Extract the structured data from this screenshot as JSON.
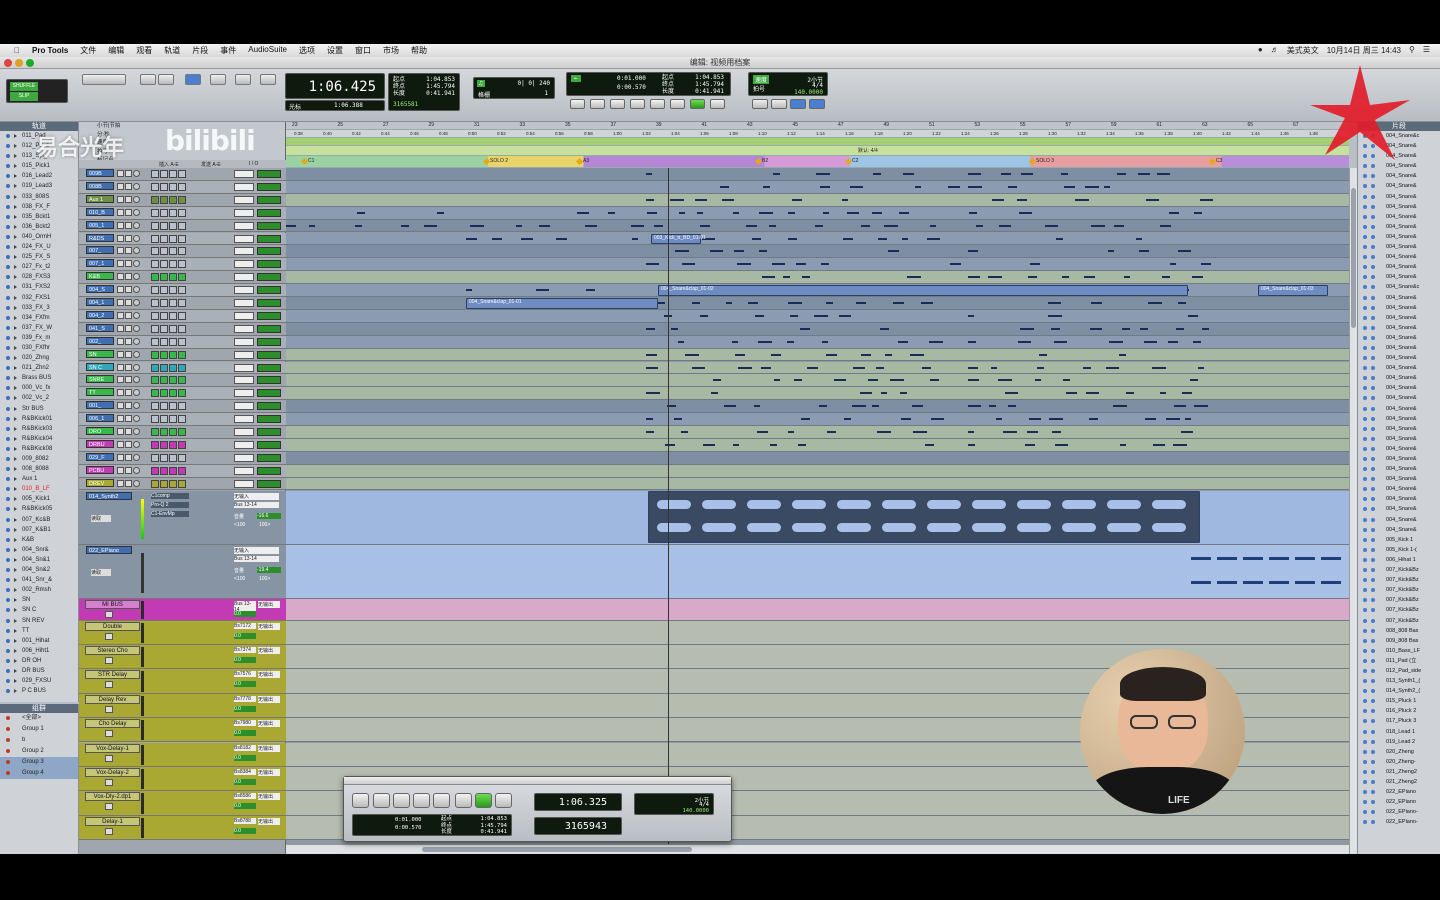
{
  "menubar": {
    "app_name": "Pro Tools",
    "items": [
      "文件",
      "编辑",
      "观看",
      "轨道",
      "片段",
      "事件",
      "AudioSuite",
      "选项",
      "设置",
      "窗口",
      "市场",
      "帮助"
    ],
    "input_method": "美式英文",
    "clock": "10月14日 周三  14:43"
  },
  "window": {
    "title": "编辑: 视频用档案"
  },
  "toolbar": {
    "mode_label": "SHUFFLE",
    "mode_sub": "SLIP",
    "main_counter": "1:06.425",
    "start_label": "起点",
    "end_label": "终点",
    "length_label": "长度",
    "start": "1:04.853",
    "end": "1:45.794",
    "length": "0:41.941",
    "cursor_label": "光标",
    "cursor_value": "1:06.388",
    "samples": "3165581",
    "nudge_value": "0| 0| 240",
    "grid_label": "格栅",
    "grid_value": "1",
    "preroll": "0:01.000",
    "postroll": "0:00.570",
    "tempo_label": "速度",
    "meter_label": "拍号",
    "meter_value": "4/4",
    "tempo_value": "140.0000",
    "beats_label": "2小节"
  },
  "rulers": {
    "labels": [
      "小节|节拍",
      "分:秒",
      "速度",
      "拍号",
      "标记点"
    ],
    "bar_numbers": [
      "23",
      "25",
      "27",
      "29",
      "31",
      "33",
      "35",
      "37",
      "39",
      "41",
      "43",
      "45",
      "47",
      "49",
      "51",
      "53",
      "55",
      "57",
      "59",
      "61",
      "63",
      "65",
      "67"
    ],
    "minsec": [
      "0:38",
      "0:40",
      "0:42",
      "0:44",
      "0:46",
      "0:48",
      "0:50",
      "0:52",
      "0:54",
      "0:56",
      "0:58",
      "1:00",
      "1:02",
      "1:04",
      "1:06",
      "1:08",
      "1:10",
      "1:12",
      "1:14",
      "1:16",
      "1:18",
      "1:20",
      "1:22",
      "1:24",
      "1:26",
      "1:28",
      "1:30",
      "1:32",
      "1:34",
      "1:36",
      "1:38",
      "1:40",
      "1:42",
      "1:44",
      "1:46",
      "1:48"
    ],
    "meter_marker": "默认: 4/4",
    "markers": [
      "C1",
      "SOLO 2",
      "A3",
      "B2",
      "C2",
      "SOLO 3",
      "C3"
    ]
  },
  "tracklist": {
    "title": "轨道",
    "items": [
      "011_Pad",
      "012_Pd_s",
      "013_Syl_",
      "015_Pick1",
      "016_Lead2",
      "019_Lead3",
      "033_808S",
      "038_FX_F",
      "035_Bckt1",
      "036_Bckt2",
      "040_OrmH",
      "024_FX_U",
      "025_FX_S",
      "027_Fx_t2",
      "028_FXS3",
      "031_FXS2",
      "032_FXS1",
      "033_FX_3",
      "034_FXfm",
      "037_FX_W",
      "039_Fx_m",
      "030_FXfhr",
      "020_Zhng",
      "021_Zhn2",
      "Brass BUS",
      "000_Vc_fx",
      "002_Vc_2",
      "Str BUS",
      "R&BKick01",
      "R&BKick03",
      "R&BKick04",
      "R&BKick08",
      "009_8082",
      "008_8088",
      "Aux 1",
      "010_B_LF",
      "005_Kick1",
      "R&BKick05",
      "007_Kc&B",
      "007_K&B1",
      "K&B",
      "004_Snr&",
      "004_Sn&1",
      "004_Sn&2",
      "041_Snr_&",
      "002_Rmsh",
      "SN",
      "SN C",
      "SN REV",
      "TT",
      "001_Hihat",
      "006_Hiht1",
      "DR OH",
      "DR BUS",
      "029_FXSU",
      "P C BUS"
    ]
  },
  "groups": {
    "title": "组群",
    "items": [
      "<全部>",
      "Group 1",
      "b",
      "Group 2",
      "Group 3",
      "Group 4"
    ]
  },
  "mixer": {
    "inserts_label": "插入 A-E",
    "sends_label": "发送 A-E",
    "io_label": "I / O",
    "tracks": [
      {
        "name": "009B",
        "color": "#3f6fb0"
      },
      {
        "name": "008B",
        "color": "#3f6fb0"
      },
      {
        "name": "Aux 1",
        "color": "#6f8f46"
      },
      {
        "name": "010_B",
        "color": "#3f6fb0"
      },
      {
        "name": "005_1",
        "color": "#3f6fb0"
      },
      {
        "name": "R&DS",
        "color": "#3f6fb0"
      },
      {
        "name": "007_",
        "color": "#3f6fb0"
      },
      {
        "name": "007_1",
        "color": "#3f6fb0"
      },
      {
        "name": "K&B",
        "color": "#37b84a"
      },
      {
        "name": "004_S",
        "color": "#3f6fb0"
      },
      {
        "name": "004_1",
        "color": "#3f6fb0"
      },
      {
        "name": "004_2",
        "color": "#3f6fb0"
      },
      {
        "name": "041_S",
        "color": "#3f6fb0"
      },
      {
        "name": "002_",
        "color": "#3f6fb0"
      },
      {
        "name": "SN",
        "color": "#37b84a"
      },
      {
        "name": "SN C",
        "color": "#31a6b5"
      },
      {
        "name": "SNRE",
        "color": "#37b84a"
      },
      {
        "name": "TT",
        "color": "#37b84a"
      },
      {
        "name": "001_",
        "color": "#3f6fb0"
      },
      {
        "name": "006_1",
        "color": "#3f6fb0"
      },
      {
        "name": "DRO",
        "color": "#37b84a"
      },
      {
        "name": "DRBU",
        "color": "#c23bb5"
      },
      {
        "name": "029_F",
        "color": "#3f6fb0"
      },
      {
        "name": "PCBU",
        "color": "#c23bb5"
      },
      {
        "name": "DREV",
        "color": "#a8a832"
      }
    ],
    "big_tracks": [
      {
        "name": "014_Synth2",
        "plugin1": "C1comp",
        "plugin2": "Pro-Q 2",
        "plugin3": "C1-EnvMp",
        "out": "Bus 13-14",
        "vol": "-16.6",
        "pan_l": "<100",
        "pan_r": "100>",
        "auto": "读取",
        "in": "无输入",
        "vol_label": "音量"
      },
      {
        "name": "022_EPiano",
        "plugin1": "",
        "plugin2": "",
        "plugin3": "",
        "out": "Bus 13-14",
        "vol": "-19.4",
        "pan_l": "<100",
        "pan_r": "100>",
        "auto": "读取",
        "in": "无输入",
        "vol_label": "音量"
      }
    ],
    "aux_tracks": [
      {
        "name": "MI BUS",
        "color": "#c23bb5",
        "io": "Bus 13-14"
      },
      {
        "name": "Double",
        "color": "#a8a832",
        "io": "Bs7172"
      },
      {
        "name": "Stereo Cho",
        "color": "#a8a832",
        "io": "Bs7374"
      },
      {
        "name": "STR Delay",
        "color": "#a8a832",
        "io": "Bs7576"
      },
      {
        "name": "Delay Rev",
        "color": "#a8a832",
        "io": "Bs7778"
      },
      {
        "name": "Cho Delay",
        "color": "#a8a832",
        "io": "Bs7980"
      },
      {
        "name": "Vox-Delay-1",
        "color": "#a8a832",
        "io": "Bs8182"
      },
      {
        "name": "Vox-Delay-2",
        "color": "#a8a832",
        "io": "Bs8384"
      },
      {
        "name": "Vox-Dly-2.dp1",
        "color": "#a8a832",
        "io": "Bs8586"
      },
      {
        "name": "Delay-1",
        "color": "#a8a832",
        "io": "Bs8788"
      }
    ],
    "aux_vol": "0.0",
    "aux_out": "无输出"
  },
  "clips": {
    "c1": "004_Snare&clap_01-02",
    "c2": "004_Snare&clap_01-03",
    "c3": "004_Snare&clap_01-03",
    "c4": "004_Snare&clap_01-01",
    "c5": "003_Kick_tr_BD_01-01"
  },
  "regions": {
    "title": "片段",
    "items": [
      "004_Snare&c",
      "004_Snare&",
      "004_Snare&",
      "004_Snare&",
      "004_Snare&",
      "004_Snare&",
      "004_Snare&",
      "004_Snare&",
      "004_Snare&",
      "004_Snare&",
      "004_Snare&",
      "004_Snare&",
      "004_Snare&",
      "004_Snare&",
      "004_Snare&",
      "004_Snare&c",
      "004_Snare&",
      "004_Snare&",
      "004_Snare&",
      "004_Snare&",
      "004_Snare&",
      "004_Snare&",
      "004_Snare&",
      "004_Snare&",
      "004_Snare&",
      "004_Snare&",
      "004_Snare&",
      "004_Snare&",
      "004_Snare&",
      "004_Snare&",
      "004_Snare&",
      "004_Snare&",
      "004_Snare&",
      "004_Snare&",
      "004_Snare&",
      "004_Snare&",
      "004_Snare&",
      "004_Snare&",
      "004_Snare&",
      "004_Snare&",
      "005_Kick 1",
      "005_Kick 1-(",
      "006_Hihat 1",
      "007_Kick&Bz",
      "007_Kick&Bz",
      "007_Kick&Bz",
      "007_Kick&Bz",
      "007_Kick&Bz",
      "007_Kick&Bz",
      "008_808 Bas",
      "009_808 Bas",
      "010_Bass_LF",
      "011_Pad (立",
      "012_Pad_side",
      "013_Synth1_(",
      "014_Synth2_(",
      "015_Pluck 1",
      "016_Pluck 2",
      "017_Pluck 3",
      "018_Lead 1",
      "019_Lead 2",
      "020_Zheng",
      "020_Zheng-",
      "021_Zheng2",
      "021_Zheng2",
      "022_EPiano",
      "022_EPiano",
      "022_EPiano-",
      "022_EPiano-"
    ]
  },
  "transport": {
    "counter": "1:06.325",
    "samples": "3165943",
    "preroll": "0:01.000",
    "postroll": "0:00.570",
    "start": "1:04.853",
    "end": "1:45.794",
    "length": "0:41.941",
    "start_label": "起点",
    "end_label": "终点",
    "length_label": "长度",
    "meter": "4/4",
    "tempo": "140.0000",
    "beats": "2小节"
  },
  "overlay": {
    "watermark": "易合光年",
    "bilibili": "bilibili",
    "shirt_text": "LIFE"
  }
}
